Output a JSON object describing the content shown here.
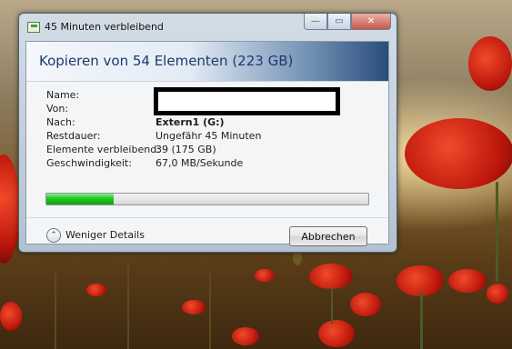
{
  "window": {
    "title": "45 Minuten verbleibend",
    "caption_buttons": {
      "minimize": "—",
      "maximize": "▭",
      "close": "✕"
    }
  },
  "header": {
    "title": "Kopieren von 54 Elementen (223 GB)"
  },
  "details": {
    "name_label": "Name:",
    "from_label": "Von:",
    "to_label": "Nach:",
    "to_value": "Extern1 (G:)",
    "remaining_label": "Restdauer:",
    "remaining_value": "Ungefähr 45 Minuten",
    "items_label": "Elemente verbleibend:",
    "items_value": "39 (175 GB)",
    "speed_label": "Geschwindigkeit:",
    "speed_value": "67,0 MB/Sekunde"
  },
  "progress": {
    "fraction": 0.21,
    "color": "#22c322"
  },
  "footer": {
    "details_toggle_icon": "chevron-up-icon",
    "details_toggle_label": "Weniger Details",
    "cancel_label": "Abbrechen"
  }
}
